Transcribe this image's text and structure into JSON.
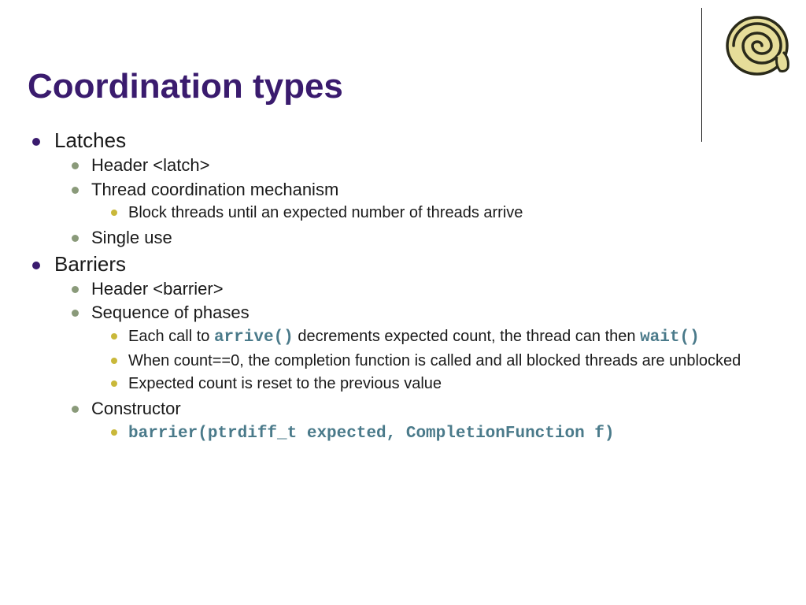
{
  "title": "Coordination types",
  "items": [
    {
      "label": "Latches",
      "children": [
        {
          "label": "Header <latch>"
        },
        {
          "label": "Thread coordination mechanism",
          "children": [
            {
              "label": "Block threads until an expected number of threads arrive"
            }
          ]
        },
        {
          "label": "Single use"
        }
      ]
    },
    {
      "label": "Barriers",
      "children": [
        {
          "label": "Header <barrier>"
        },
        {
          "label": "Sequence of phases",
          "children": [
            {
              "label_parts": [
                {
                  "text": "Each call to "
                },
                {
                  "text": "arrive()",
                  "code": true
                },
                {
                  "text": " decrements expected count, the thread can then "
                },
                {
                  "text": "wait()",
                  "code": true
                }
              ]
            },
            {
              "label": "When count==0, the completion function is called and all blocked threads are unblocked"
            },
            {
              "label": "Expected count is reset to the previous value"
            }
          ]
        },
        {
          "label": "Constructor",
          "children": [
            {
              "label_parts": [
                {
                  "text": "barrier(ptrdiff_t expected, CompletionFunction f)",
                  "code": true
                }
              ]
            }
          ]
        }
      ]
    }
  ]
}
